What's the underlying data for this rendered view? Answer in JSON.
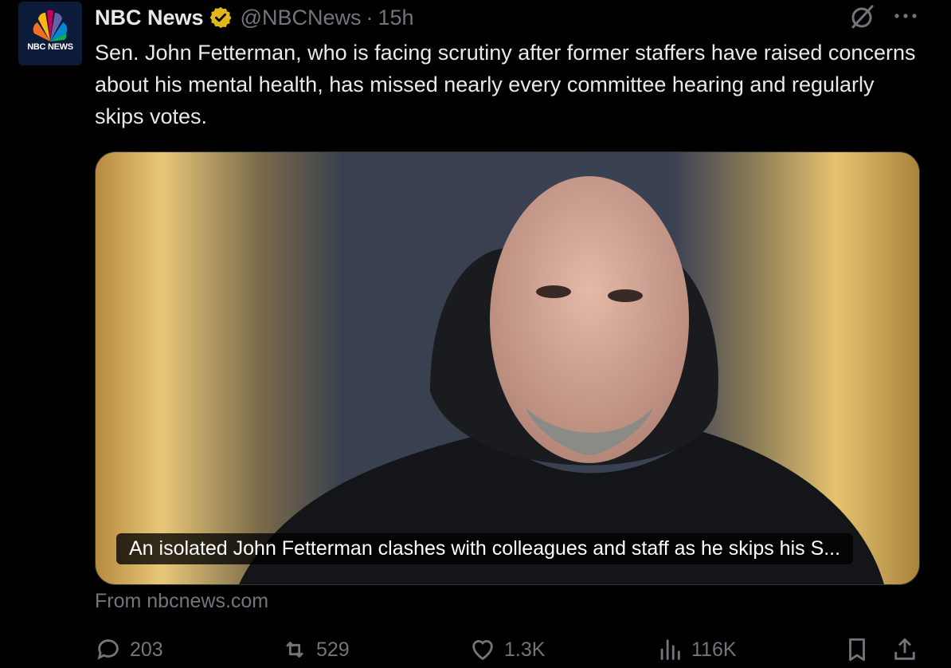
{
  "post": {
    "author_name": "NBC News",
    "avatar_text": "NBC NEWS",
    "handle": "@NBCNews",
    "separator": "·",
    "time": "15h",
    "text": "Sen. John Fetterman, who is facing scrutiny after former staffers have raised concerns about his mental health, has missed nearly every committee hearing and regularly skips votes.",
    "card": {
      "title": "An isolated John Fetterman clashes with colleagues and staff as he skips his S...",
      "source": "From nbcnews.com"
    },
    "actions": {
      "replies": "203",
      "reposts": "529",
      "likes": "1.3K",
      "views": "116K"
    }
  },
  "colors": {
    "background": "#000000",
    "text": "#e7e9ea",
    "muted": "#71767b",
    "verified_badge": "#e2b719"
  },
  "icons": [
    "grok-icon",
    "more-icon",
    "verified-badge-icon",
    "reply-icon",
    "repost-icon",
    "like-icon",
    "views-icon",
    "bookmark-icon",
    "share-icon"
  ]
}
